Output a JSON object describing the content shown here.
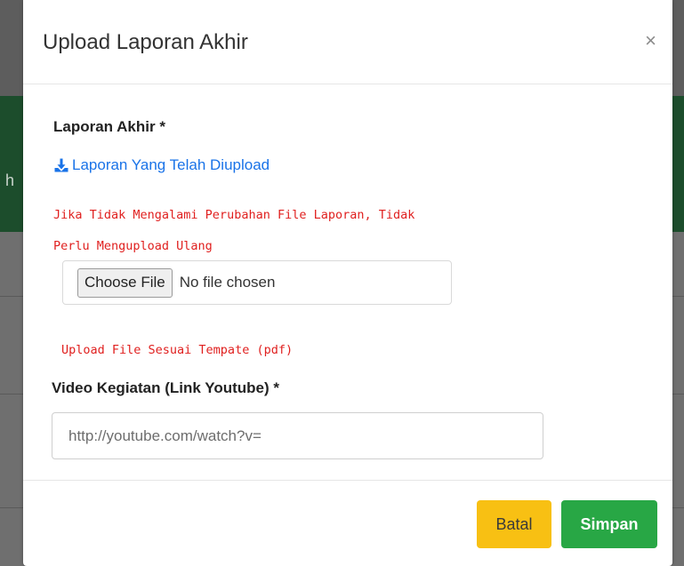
{
  "modal": {
    "title": "Upload Laporan Akhir",
    "close_icon": "×"
  },
  "form": {
    "report_label": "Laporan Akhir *",
    "download_link_label": "Laporan Yang Telah Diupload",
    "note_line1": "Jika Tidak Mengalami Perubahan File Laporan, Tidak",
    "note_line2": "Perlu Mengupload Ulang",
    "file_button_label": "Choose File",
    "file_status": "No file chosen",
    "upload_hint": "Upload File Sesuai Tempate (pdf)",
    "video_label": "Video Kegiatan (Link Youtube) *",
    "video_placeholder": "http://youtube.com/watch?v="
  },
  "footer": {
    "cancel_label": "Batal",
    "save_label": "Simpan"
  },
  "background": {
    "partial_letter": "h"
  },
  "colors": {
    "link": "#1a73e8",
    "warning_text": "#e0201f",
    "cancel_button": "#f8c013",
    "save_button": "#28a745"
  },
  "icons": {
    "download": "download-icon",
    "close": "close-icon"
  }
}
